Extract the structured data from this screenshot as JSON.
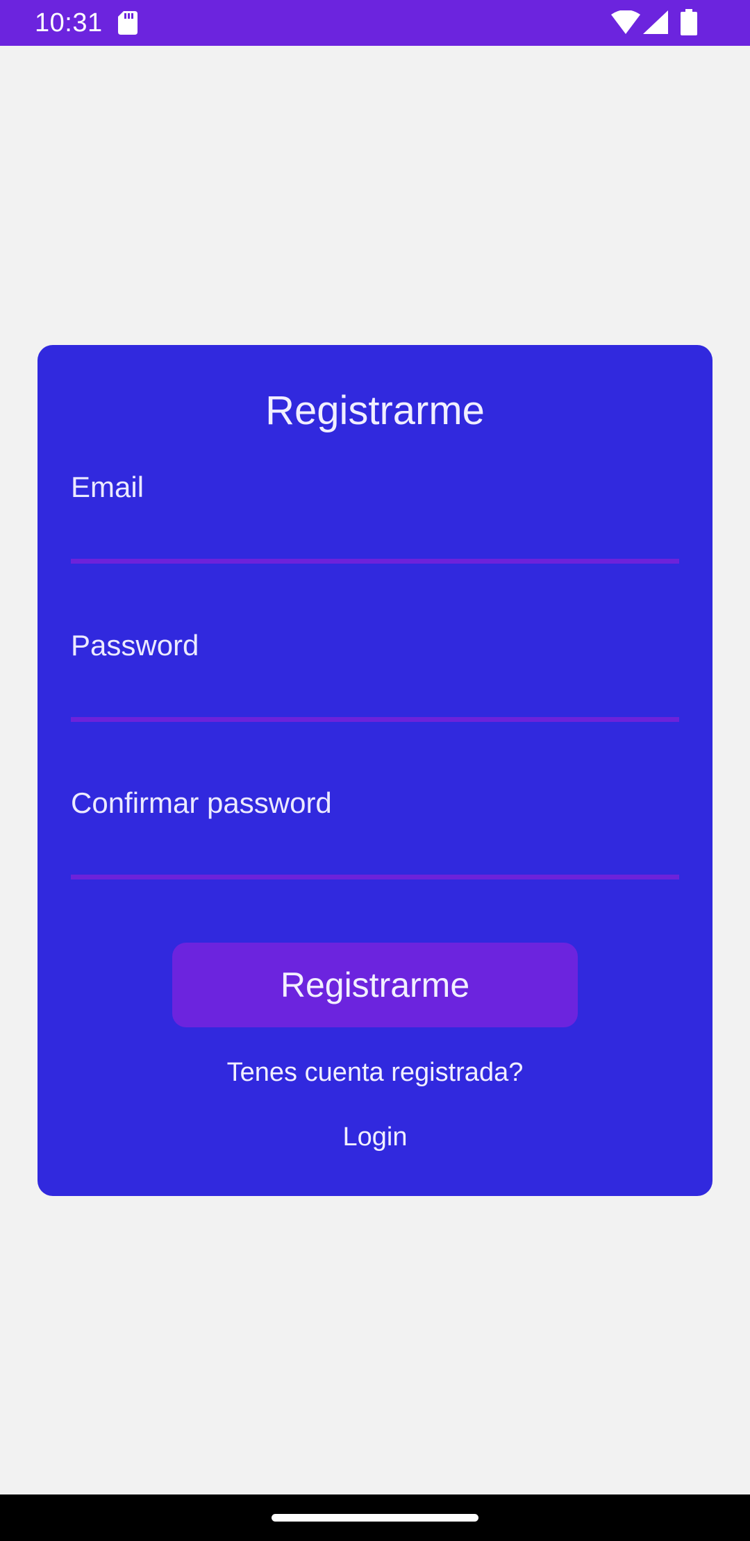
{
  "status_bar": {
    "time": "10:31",
    "icons": [
      "sd-card-icon",
      "wifi-icon",
      "cell-signal-icon",
      "battery-icon"
    ],
    "background_color": "#6c24de"
  },
  "register_form": {
    "title": "Registrarme",
    "fields": [
      {
        "label": "Email",
        "value": ""
      },
      {
        "label": "Password",
        "value": ""
      },
      {
        "label": "Confirmar password",
        "value": ""
      }
    ],
    "submit_label": "Registrarme",
    "have_account_text": "Tenes cuenta registrada?",
    "login_link": "Login",
    "card_color": "#3129de",
    "accent_color": "#6c24de"
  },
  "nav_bar": {
    "gesture": "home-handle"
  }
}
